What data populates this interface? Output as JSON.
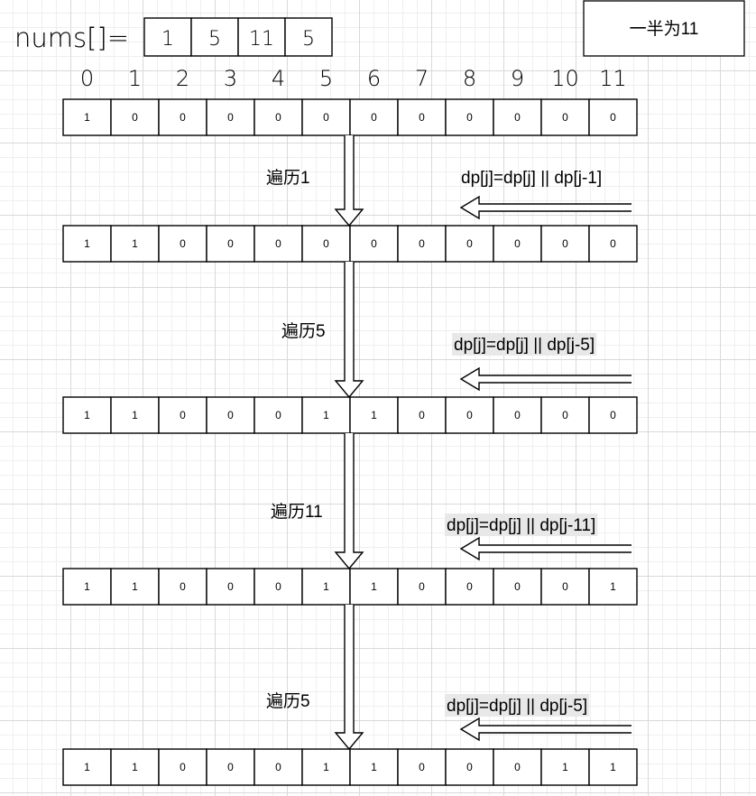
{
  "nums": {
    "label": "nums[]=",
    "values": [
      "1",
      "5",
      "11",
      "5"
    ]
  },
  "target_box": {
    "label": "一半为11"
  },
  "indices": [
    "0",
    "1",
    "2",
    "3",
    "4",
    "5",
    "6",
    "7",
    "8",
    "9",
    "10",
    "11"
  ],
  "dp_rows": [
    [
      "1",
      "0",
      "0",
      "0",
      "0",
      "0",
      "0",
      "0",
      "0",
      "0",
      "0",
      "0"
    ],
    [
      "1",
      "1",
      "0",
      "0",
      "0",
      "0",
      "0",
      "0",
      "0",
      "0",
      "0",
      "0"
    ],
    [
      "1",
      "1",
      "0",
      "0",
      "0",
      "1",
      "1",
      "0",
      "0",
      "0",
      "0",
      "0"
    ],
    [
      "1",
      "1",
      "0",
      "0",
      "0",
      "1",
      "1",
      "0",
      "0",
      "0",
      "0",
      "1"
    ],
    [
      "1",
      "1",
      "0",
      "0",
      "0",
      "1",
      "1",
      "0",
      "0",
      "0",
      "1",
      "1"
    ]
  ],
  "steps": [
    {
      "label": "遍历1",
      "formula": "dp[j]=dp[j] || dp[j-1]",
      "highlight": false
    },
    {
      "label": "遍历5",
      "formula": "dp[j]=dp[j] || dp[j-5]",
      "highlight": true
    },
    {
      "label": "遍历11",
      "formula": "dp[j]=dp[j] || dp[j-11]",
      "highlight": true
    },
    {
      "label": "遍历5",
      "formula": "dp[j]=dp[j] || dp[j-5]",
      "highlight": true
    }
  ],
  "colors": {
    "line": "#000000",
    "highlight": "#e8e8e8",
    "arrow_fill": "#ffffff"
  }
}
